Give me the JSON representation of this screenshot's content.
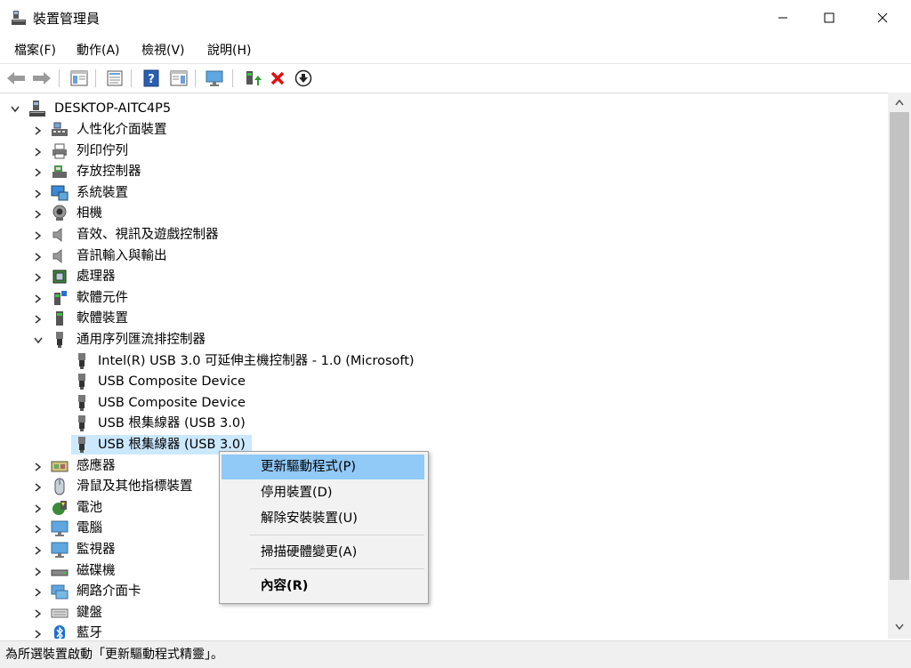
{
  "window": {
    "title": "裝置管理員"
  },
  "menu": [
    "檔案(F)",
    "動作(A)",
    "檢視(V)",
    "說明(H)"
  ],
  "tree": {
    "root": "DESKTOP-AITC4P5",
    "categories": [
      {
        "label": "人性化介面裝置",
        "icon": "hid-icon"
      },
      {
        "label": "列印佇列",
        "icon": "printer-icon"
      },
      {
        "label": "存放控制器",
        "icon": "storage-controller-icon"
      },
      {
        "label": "系統裝置",
        "icon": "system-device-icon"
      },
      {
        "label": "相機",
        "icon": "camera-icon"
      },
      {
        "label": "音效、視訊及遊戲控制器",
        "icon": "speaker-icon"
      },
      {
        "label": "音訊輸入與輸出",
        "icon": "speaker-icon"
      },
      {
        "label": "處理器",
        "icon": "processor-icon"
      },
      {
        "label": "軟體元件",
        "icon": "software-component-icon"
      },
      {
        "label": "軟體裝置",
        "icon": "software-device-icon"
      },
      {
        "label": "通用序列匯流排控制器",
        "icon": "usb-icon",
        "expanded": true
      },
      {
        "label": "感應器",
        "icon": "sensor-icon"
      },
      {
        "label": "滑鼠及其他指標裝置",
        "icon": "mouse-icon"
      },
      {
        "label": "電池",
        "icon": "battery-icon"
      },
      {
        "label": "電腦",
        "icon": "computer-icon"
      },
      {
        "label": "監視器",
        "icon": "monitor-icon"
      },
      {
        "label": "磁碟機",
        "icon": "disk-drive-icon"
      },
      {
        "label": "網路介面卡",
        "icon": "network-adapter-icon"
      },
      {
        "label": "鍵盤",
        "icon": "keyboard-icon"
      },
      {
        "label": "藍牙",
        "icon": "bluetooth-icon"
      }
    ],
    "usb_children": [
      "Intel(R) USB 3.0 可延伸主機控制器 - 1.0 (Microsoft)",
      "USB Composite Device",
      "USB Composite Device",
      "USB 根集線器 (USB 3.0)",
      "USB 根集線器 (USB 3.0)"
    ]
  },
  "context_menu": {
    "items": [
      "更新驅動程式(P)",
      "停用裝置(D)",
      "解除安裝裝置(U)",
      "掃描硬體變更(A)",
      "內容(R)"
    ]
  },
  "status": "為所選裝置啟動「更新驅動程式精靈」。"
}
